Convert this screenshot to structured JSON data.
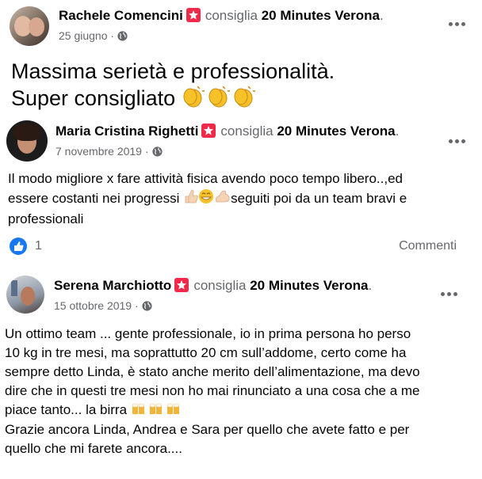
{
  "reviews": [
    {
      "name": "Rachele Comencini",
      "verb": "consiglia",
      "page": "20 Minutes Verona",
      "punct": ".",
      "date": "25 giugno",
      "separator": "·",
      "text_lines": [
        "Massima serietà e professionalità.",
        "Super consigliato"
      ]
    },
    {
      "name": "Maria Cristina Righetti",
      "verb": "consiglia",
      "page": "20 Minutes Verona",
      "punct": ".",
      "date": "7 novembre 2019",
      "separator": "·",
      "text_lines": [
        "Il modo migliore x fare attività fisica avendo poco tempo libero..,ed",
        "essere costanti nei progressi",
        "seguiti poi da un team bravi e",
        "professionali"
      ],
      "like_count": "1",
      "comments_label": "Commenti"
    },
    {
      "name": "Serena Marchiotto",
      "verb": "consiglia",
      "page": "20 Minutes Verona",
      "punct": ".",
      "date": "15 ottobre 2019",
      "separator": "·",
      "text_lines": [
        "Un ottimo team ... gente professionale, io in prima persona ho perso",
        "10 kg in tre mesi, ma soprattutto 20 cm sull’addome, certo come ha",
        "sempre detto Linda, è stato anche merito dell’alimentazione, ma devo",
        "dire che in questi tre mesi non ho mai rinunciato a una cosa che a me",
        "piace tanto... la birra",
        "Grazie ancora Linda, Andrea e Sara per quello che avete fatto e per",
        "quello che mi farete ancora...."
      ]
    }
  ],
  "icons": {
    "recommend": "recommend-icon",
    "globe": "globe-icon",
    "more": "more-options-icon",
    "like": "like-icon"
  },
  "colors": {
    "recommend_red": "#f02849",
    "like_blue": "#1877f2",
    "secondary_text": "#65676b"
  }
}
